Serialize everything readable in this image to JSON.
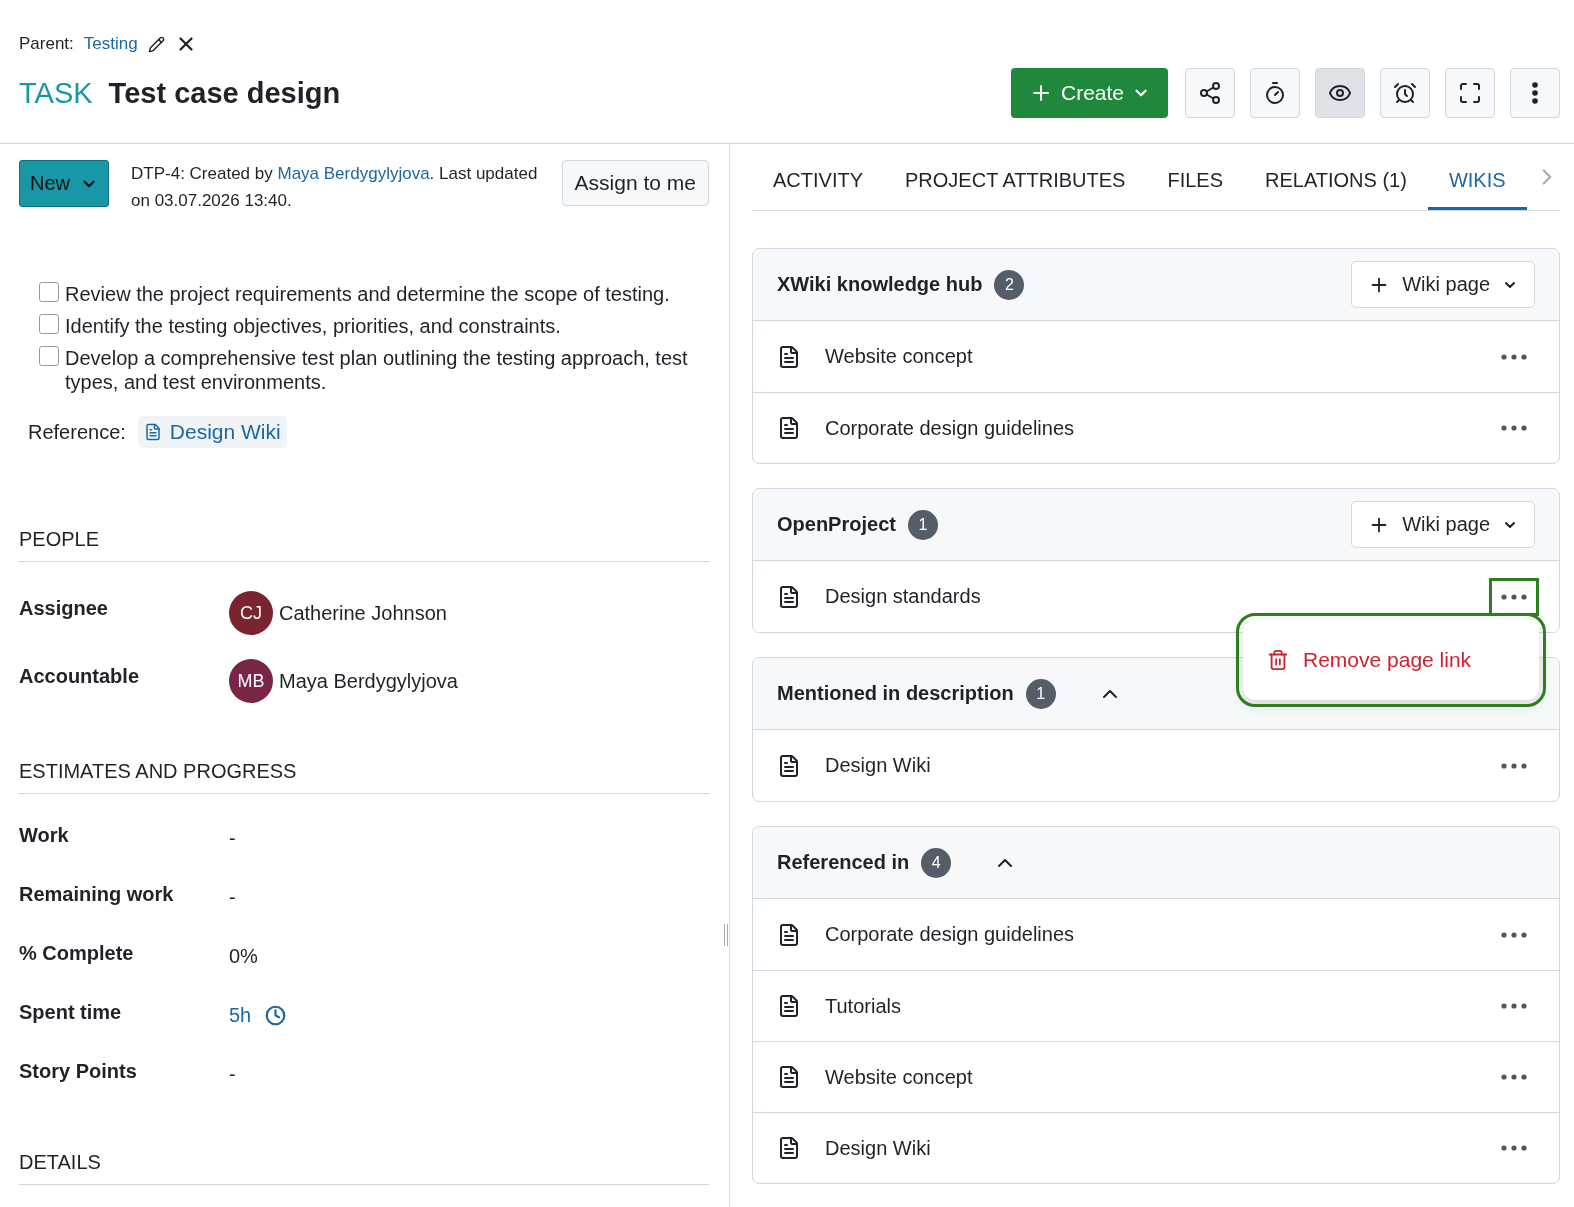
{
  "parent": {
    "label": "Parent:",
    "link": "Testing"
  },
  "type": "TASK",
  "title": "Test case design",
  "toolbar": {
    "create": "Create",
    "buttons": [
      {
        "kind": "share",
        "selected": false
      },
      {
        "kind": "timer",
        "selected": false
      },
      {
        "kind": "watch",
        "selected": true
      },
      {
        "kind": "reminder",
        "selected": false
      },
      {
        "kind": "fullscreen",
        "selected": false
      },
      {
        "kind": "more",
        "selected": false
      }
    ]
  },
  "status": "New",
  "meta": {
    "prefix": "DTP-4: Created by ",
    "author": "Maya Berdygylyjova",
    "suffix": ". Last updated on 03.07.2026 13:40."
  },
  "assign_button": "Assign to me",
  "checklist": [
    {
      "text": "Review the project requirements and determine the scope of testing.",
      "checked": false
    },
    {
      "text": "Identify the testing objectives, priorities, and constraints.",
      "checked": false
    },
    {
      "text": "Develop a comprehensive test plan outlining the testing approach, test types, and test environments.",
      "checked": false
    }
  ],
  "reference": {
    "label": "Reference:",
    "link": "Design Wiki"
  },
  "groups": [
    {
      "title": "PEOPLE",
      "fields": [
        {
          "label": "Assignee",
          "kind": "user",
          "initials": "CJ",
          "value": "Catherine Johnson",
          "color": "#7a2430"
        },
        {
          "label": "Accountable",
          "kind": "user",
          "initials": "MB",
          "value": "Maya Berdygylyjova",
          "color": "#7a2448"
        }
      ]
    },
    {
      "title": "ESTIMATES AND PROGRESS",
      "fields": [
        {
          "label": "Work",
          "kind": "text",
          "value": "-"
        },
        {
          "label": "Remaining work",
          "kind": "text",
          "value": "-"
        },
        {
          "label": "% Complete",
          "kind": "text",
          "value": "0%"
        },
        {
          "label": "Spent time",
          "kind": "time",
          "value": "5h"
        },
        {
          "label": "Story Points",
          "kind": "text",
          "value": "-"
        }
      ]
    },
    {
      "title": "DETAILS"
    }
  ],
  "tabs": [
    {
      "label": "ACTIVITY",
      "selected": false
    },
    {
      "label": "PROJECT ATTRIBUTES",
      "selected": false
    },
    {
      "label": "FILES",
      "selected": false
    },
    {
      "label": "RELATIONS (1)",
      "selected": false
    },
    {
      "label": "WIKIS",
      "selected": true
    }
  ],
  "sections": [
    {
      "title": "XWiki knowledge hub",
      "count": "2",
      "kind": "provider",
      "add_label": "Wiki page",
      "items": [
        {
          "title": "Website concept",
          "highlighted": false
        },
        {
          "title": "Corporate design guidelines",
          "highlighted": false
        }
      ]
    },
    {
      "title": "OpenProject",
      "count": "1",
      "kind": "provider",
      "add_label": "Wiki page",
      "items": [
        {
          "title": "Design standards",
          "highlighted": true,
          "menu": {
            "highlighted": true,
            "items": [
              {
                "label": "Remove page link"
              }
            ]
          }
        }
      ]
    },
    {
      "title": "Mentioned in description",
      "count": "1",
      "kind": "collapsible",
      "expanded": true,
      "items": [
        {
          "title": "Design Wiki",
          "highlighted": false
        }
      ]
    },
    {
      "title": "Referenced in",
      "count": "4",
      "kind": "collapsible",
      "expanded": true,
      "items": [
        {
          "title": "Corporate design guidelines",
          "highlighted": false
        },
        {
          "title": "Tutorials",
          "highlighted": false
        },
        {
          "title": "Website concept",
          "highlighted": false
        },
        {
          "title": "Design Wiki",
          "highlighted": false
        }
      ]
    }
  ]
}
